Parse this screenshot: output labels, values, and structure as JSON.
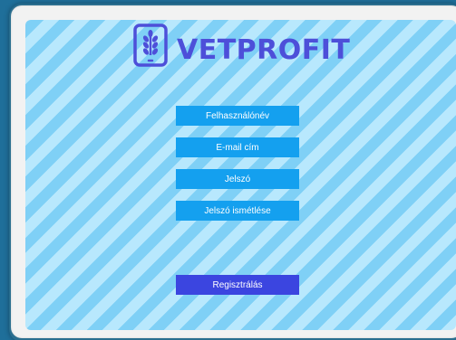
{
  "brand": {
    "name": "VETPROFIT",
    "logo_icon": "tablet-wheat-icon",
    "color": "#4d4fd9"
  },
  "form": {
    "fields": [
      {
        "label": "Felhasználónév"
      },
      {
        "label": "E-mail cím"
      },
      {
        "label": "Jelszó"
      },
      {
        "label": "Jelszó ismétlése"
      }
    ],
    "field_color": "#14a0ef",
    "submit_label": "Regisztrálás",
    "submit_color": "#3b45e0"
  },
  "background": {
    "stripe_light": "#b8e8fd",
    "stripe_dark": "#7fd0f6"
  }
}
